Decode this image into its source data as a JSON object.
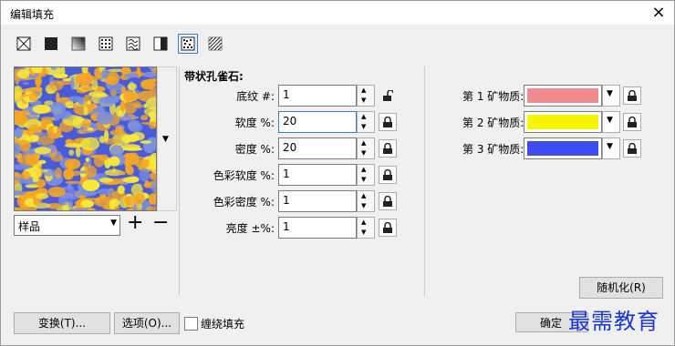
{
  "dialog": {
    "title": "编辑填充",
    "close_icon": "×"
  },
  "fill_types": [
    {
      "name": "no-fill",
      "active": false
    },
    {
      "name": "uniform-fill",
      "active": false
    },
    {
      "name": "fountain-fill",
      "active": false
    },
    {
      "name": "vector-pattern-fill",
      "active": false
    },
    {
      "name": "bitmap-pattern-fill",
      "active": false
    },
    {
      "name": "two-color-pattern-fill",
      "active": false
    },
    {
      "name": "texture-fill",
      "active": true
    },
    {
      "name": "postscript-fill",
      "active": false
    }
  ],
  "preview": {
    "texture_colors": [
      "#f5a623",
      "#f7e83a",
      "#4a5bd9",
      "#7c8fe0"
    ],
    "sample_combo": "样品"
  },
  "texture": {
    "name": "带状孔雀石:",
    "params": [
      {
        "label": "底纹 #:",
        "value": "1",
        "locked": false,
        "focused": false
      },
      {
        "label": "软度 %:",
        "value": "20",
        "locked": true,
        "focused": true
      },
      {
        "label": "密度 %:",
        "value": "20",
        "locked": true,
        "focused": false
      },
      {
        "label": "色彩软度 %:",
        "value": "1",
        "locked": true,
        "focused": false
      },
      {
        "label": "色彩密度 %:",
        "value": "1",
        "locked": true,
        "focused": false
      },
      {
        "label": "亮度 ±%:",
        "value": "1",
        "locked": true,
        "focused": false
      }
    ]
  },
  "minerals": [
    {
      "label": "第 1 矿物质:",
      "color": "#f28b8f"
    },
    {
      "label": "第 2 矿物质:",
      "color": "#f5f500"
    },
    {
      "label": "第 3 矿物质:",
      "color": "#3d4cf0"
    }
  ],
  "buttons": {
    "randomize": "随机化(R)",
    "transform": "变换(T)...",
    "options": "选项(O)...",
    "wrap_fill": "缠绕填充",
    "ok": "确定"
  },
  "watermark": "最需教育"
}
